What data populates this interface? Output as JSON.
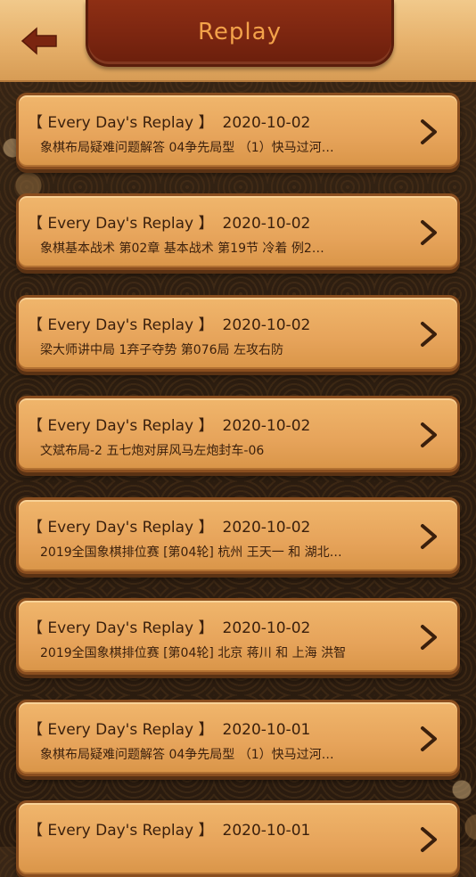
{
  "header": {
    "title": "Replay",
    "back_icon": "back-arrow-icon"
  },
  "colors": {
    "plaque": "#7a2510",
    "title": "#f3a24a",
    "card": "#e6a35a",
    "card_border": "#8a4e1f",
    "text": "#3a1f0c"
  },
  "items": [
    {
      "tag": "【 Every Day's Replay 】",
      "date": "2020-10-02",
      "subtitle": "象棋布局疑难问题解答 04争先局型 （1）快马过河…"
    },
    {
      "tag": "【 Every Day's Replay 】",
      "date": "2020-10-02",
      "subtitle": "象棋基本战术 第02章 基本战术 第19节 冷着 例2…"
    },
    {
      "tag": "【 Every Day's Replay 】",
      "date": "2020-10-02",
      "subtitle": "梁大师讲中局 1弃子夺势 第076局 左攻右防"
    },
    {
      "tag": "【 Every Day's Replay 】",
      "date": "2020-10-02",
      "subtitle": "文斌布局-2 五七炮对屏风马左炮封车-06"
    },
    {
      "tag": "【 Every Day's Replay 】",
      "date": "2020-10-02",
      "subtitle": "2019全国象棋排位赛 [第04轮] 杭州 王天一 和 湖北…"
    },
    {
      "tag": "【 Every Day's Replay 】",
      "date": "2020-10-02",
      "subtitle": "2019全国象棋排位赛 [第04轮] 北京 蒋川 和 上海 洪智"
    },
    {
      "tag": "【 Every Day's Replay 】",
      "date": "2020-10-01",
      "subtitle": "象棋布局疑难问题解答 04争先局型 （1）快马过河…"
    },
    {
      "tag": "【 Every Day's Replay 】",
      "date": "2020-10-01",
      "subtitle": ""
    }
  ]
}
